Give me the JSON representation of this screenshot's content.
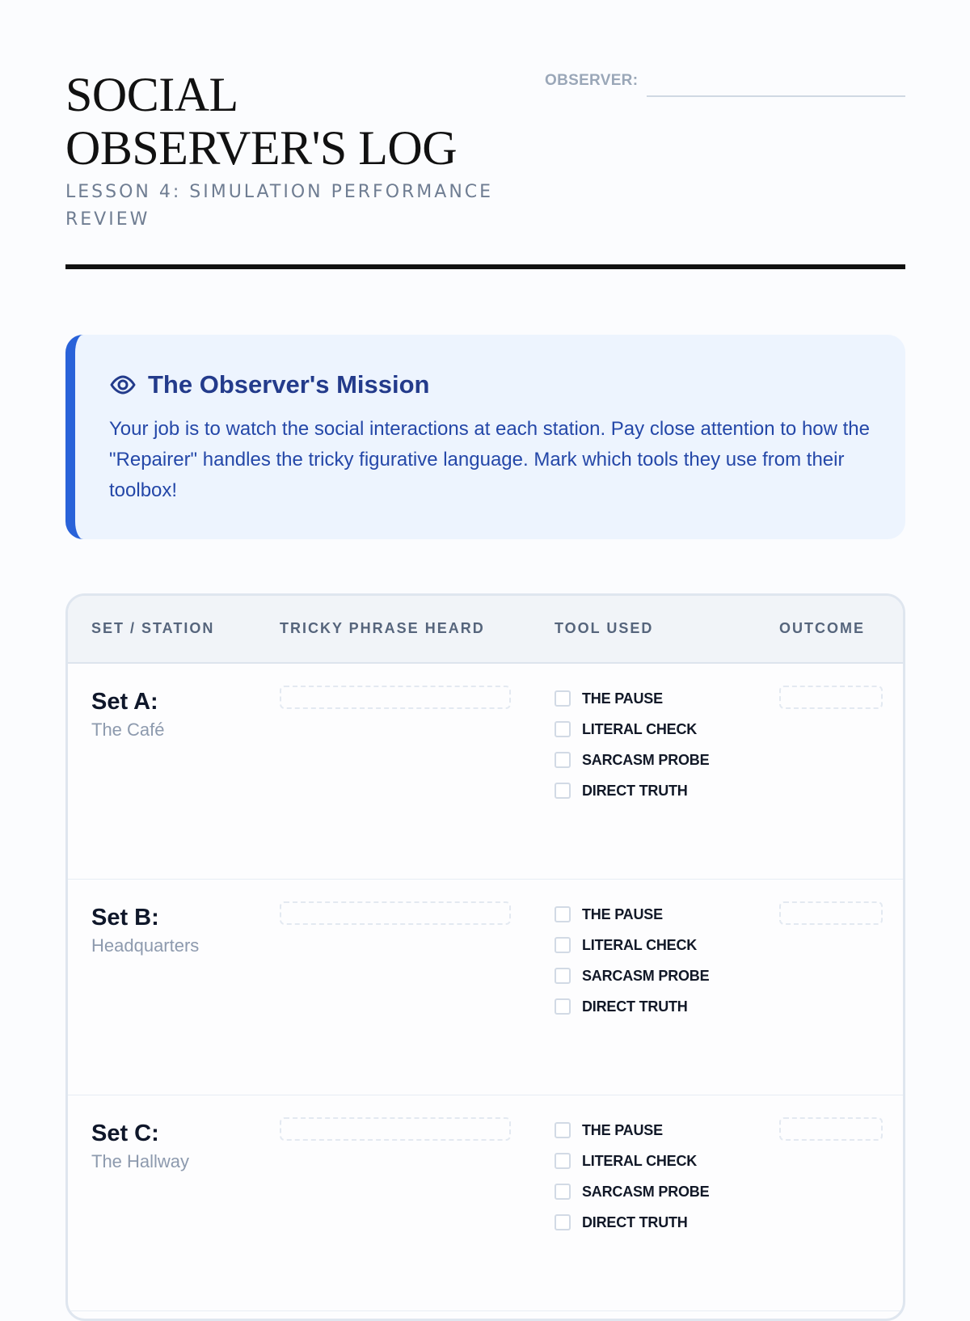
{
  "header": {
    "title": "SOCIAL OBSERVER'S LOG",
    "subtitle": "LESSON 4: SIMULATION PERFORMANCE REVIEW",
    "observer_label": "OBSERVER:",
    "observer_value": ""
  },
  "mission": {
    "icon": "eye-icon",
    "title": "The Observer's Mission",
    "text": "Your job is to watch the social interactions at each station. Pay close attention to how the \"Repairer\" handles the tricky figurative language. Mark which tools they use from their toolbox!",
    "accent_color": "#2962d9"
  },
  "table": {
    "headers": {
      "set_station": "SET / STATION",
      "tricky_phrase": "TRICKY PHRASE HEARD",
      "tool_used": "TOOL USED",
      "outcome": "OUTCOME"
    },
    "rows": [
      {
        "set": "Set A:",
        "station": "The Café",
        "tricky_phrase": "",
        "outcome": "",
        "tools": [
          {
            "label": "THE PAUSE",
            "checked": false
          },
          {
            "label": "LITERAL CHECK",
            "checked": false
          },
          {
            "label": "SARCASM PROBE",
            "checked": false
          },
          {
            "label": "DIRECT TRUTH",
            "checked": false
          }
        ]
      },
      {
        "set": "Set B:",
        "station": "Headquarters",
        "tricky_phrase": "",
        "outcome": "",
        "tools": [
          {
            "label": "THE PAUSE",
            "checked": false
          },
          {
            "label": "LITERAL CHECK",
            "checked": false
          },
          {
            "label": "SARCASM PROBE",
            "checked": false
          },
          {
            "label": "DIRECT TRUTH",
            "checked": false
          }
        ]
      },
      {
        "set": "Set C:",
        "station": "The Hallway",
        "tricky_phrase": "",
        "outcome": "",
        "tools": [
          {
            "label": "THE PAUSE",
            "checked": false
          },
          {
            "label": "LITERAL CHECK",
            "checked": false
          },
          {
            "label": "SARCASM PROBE",
            "checked": false
          },
          {
            "label": "DIRECT TRUTH",
            "checked": false
          }
        ]
      }
    ]
  }
}
